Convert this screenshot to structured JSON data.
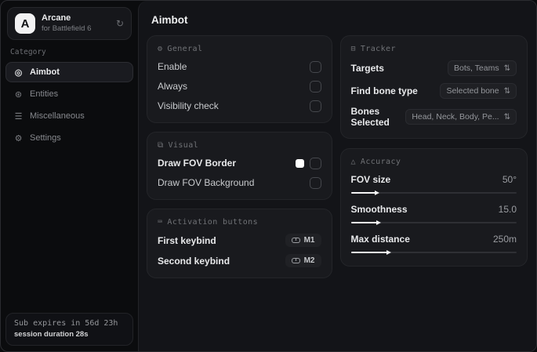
{
  "brand": {
    "logo_letter": "A",
    "name": "Arcane",
    "subtitle": "for Battlefield 6",
    "refresh_icon": "↻"
  },
  "sidebar": {
    "category_label": "Category",
    "items": [
      {
        "label": "Aimbot",
        "icon": "◎"
      },
      {
        "label": "Entities",
        "icon": "⊛"
      },
      {
        "label": "Miscellaneous",
        "icon": "☰"
      },
      {
        "label": "Settings",
        "icon": "⚙"
      }
    ],
    "sub_box": {
      "line1": "Sub expires in 56d 23h",
      "line2": "session duration 28s"
    }
  },
  "main": {
    "title": "Aimbot",
    "general": {
      "title": "General",
      "icon": "⚙",
      "rows": [
        {
          "label": "Enable",
          "checked": false
        },
        {
          "label": "Always",
          "checked": false
        },
        {
          "label": "Visibility check",
          "checked": false
        }
      ]
    },
    "visual": {
      "title": "Visual",
      "icon": "⧉",
      "rows": [
        {
          "label": "Draw FOV Border",
          "swatch_color": "#ffffff",
          "checked": false
        },
        {
          "label": "Draw FOV Background",
          "checked": false
        }
      ]
    },
    "activation": {
      "title": "Activation buttons",
      "icon": "⌨",
      "rows": [
        {
          "label": "First keybind",
          "key": "M1"
        },
        {
          "label": "Second keybind",
          "key": "M2"
        }
      ]
    },
    "tracker": {
      "title": "Tracker",
      "icon": "⊟",
      "unfold_icon": "⇅",
      "rows": [
        {
          "label": "Targets",
          "value": "Bots, Teams"
        },
        {
          "label": "Find bone type",
          "value": "Selected bone"
        },
        {
          "label": "Bones Selected",
          "value": "Head, Neck, Body, Pe..."
        }
      ]
    },
    "accuracy": {
      "title": "Accuracy",
      "icon": "△",
      "rows": [
        {
          "label": "FOV size",
          "value": "50°",
          "fill_pct": 15
        },
        {
          "label": "Smoothness",
          "value": "15.0",
          "fill_pct": 16
        },
        {
          "label": "Max distance",
          "value": "250m",
          "fill_pct": 22
        }
      ]
    }
  },
  "colors": {
    "window_bg": "#0b0c0e",
    "panel_bg": "#131418",
    "card_bg": "#191a1e",
    "card_border": "#242529",
    "swatch": "#ffffff",
    "slider_fill": "#f4f4f5"
  }
}
